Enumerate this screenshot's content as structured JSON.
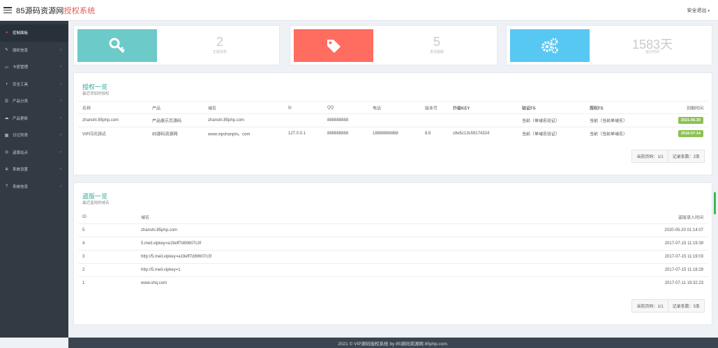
{
  "header": {
    "brand_prefix": "85源码资源网",
    "brand_highlight": "授权系统",
    "logout_label": "安全退出"
  },
  "sidebar": {
    "items": [
      {
        "label": "控制面板",
        "icon": "dashboard-icon"
      },
      {
        "label": "授权信息",
        "icon": "wrench-icon"
      },
      {
        "label": "卡密管理",
        "icon": "card-icon"
      },
      {
        "label": "安全工具",
        "icon": "shield-icon"
      },
      {
        "label": "产品分类",
        "icon": "list-icon"
      },
      {
        "label": "产品更新",
        "icon": "cloud-download-icon"
      },
      {
        "label": "日记列表",
        "icon": "calendar-icon"
      },
      {
        "label": "盗版站点",
        "icon": "globe-icon"
      },
      {
        "label": "系统设置",
        "icon": "gears-icon"
      },
      {
        "label": "系统信息",
        "icon": "question-icon"
      }
    ]
  },
  "stats": [
    {
      "value": "2",
      "label": "正版授权",
      "color": "#6ccac9",
      "icon": "key-icon"
    },
    {
      "value": "5",
      "label": "发现盗版",
      "color": "#ff6c60",
      "icon": "tag-icon"
    },
    {
      "value": "1583天",
      "label": "运行时间",
      "color": "#57c8f2",
      "icon": "gears-icon"
    }
  ],
  "auth_panel": {
    "title": "授权一览",
    "subtitle": "最近添加的授权",
    "columns": [
      "名称",
      "产品",
      "域名",
      "ip",
      "QQ",
      "电话",
      "版本号",
      "升级KEY",
      "验证FS",
      "授权FS",
      "到期时间"
    ],
    "rows": [
      {
        "name": "zhanshi.85php.com",
        "product": "产品展示页源码",
        "domain": "zhanshi.85php.com",
        "ip": "",
        "qq": "888888888",
        "phone": "",
        "version": "",
        "key": "",
        "verify": "当前（单域名验证）",
        "auth": "当前（当前单域名）",
        "expire": "2021-06-30"
      },
      {
        "name": "VIP闪讯测试",
        "product": "85源码资源网",
        "domain": "www.vipshanpin。com",
        "ip": "127.0.0.1",
        "qq": "888888888",
        "phone": "18888888888",
        "version": "8.8",
        "key": "c8e5c13c59174324",
        "verify": "当前（单域名验证）",
        "auth": "当前（当前单域名）",
        "expire": "2018-07-14"
      }
    ],
    "pager_current": "当前页码：1/1",
    "pager_total": "记录条数：2条"
  },
  "pirate_panel": {
    "title": "盗版一览",
    "subtitle": "最近盗用的域名",
    "columns": [
      "ID",
      "域名",
      "盗版录入时间"
    ],
    "rows": [
      {
        "id": "5",
        "domain": "zhanshi.85php.com",
        "time": "2020-05-20 01:14:07"
      },
      {
        "id": "4",
        "domain": "5.meil.vipkey=a19eff7d89607c3f",
        "time": "2017-07-15 11:19:39"
      },
      {
        "id": "3",
        "domain": "http://5.meil.vipkey=a19eff7d89607c3f",
        "time": "2017-07-15 11:19:03"
      },
      {
        "id": "2",
        "domain": "http://5.meil.vipkey=1",
        "time": "2017-07-15 11:18:29"
      },
      {
        "id": "1",
        "domain": "www.shq.com",
        "time": "2017-07-11 19:32:23"
      }
    ],
    "pager_current": "当前页码：1/1",
    "pager_total": "记录条数：5条"
  },
  "footer": {
    "text": "2021 © VIP源码授权系统 by 85源码资源网 85php.com."
  },
  "colors": {
    "accent": "#3aa89a",
    "sidebar_bg": "#323b44",
    "badge_green": "#8cc152",
    "danger": "#e8574b"
  }
}
